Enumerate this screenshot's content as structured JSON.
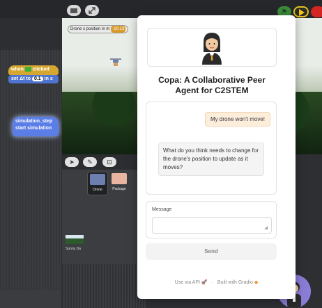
{
  "stage": {
    "readout_label": "Drone x position in m",
    "readout_value": "-20.13"
  },
  "palette": {
    "when_label": "when",
    "clicked_label": "clicked",
    "set_label": "set",
    "set_var": "Δt",
    "set_to": "to",
    "set_value": "0.1",
    "set_unit": "in s",
    "sim_block_line1": "simulation_step",
    "sim_block_line2": "start simulation"
  },
  "corral": {
    "sprites": [
      {
        "name": "Drone"
      },
      {
        "name": "Package"
      }
    ],
    "stage_name": "Sunny Da"
  },
  "modal": {
    "title": "Copa: A Collaborative Peer Agent for C2STEM",
    "messages": [
      {
        "role": "user",
        "text": "My drone won't move!"
      },
      {
        "role": "bot",
        "text": "What do you think needs to change for the drone's position to update as it moves?"
      }
    ],
    "input_label": "Message",
    "input_value": "",
    "send_label": "Send",
    "footer_api": "Use via API",
    "footer_sep": "·",
    "footer_built": "Built with Gradio"
  },
  "colors": {
    "user_bubble": "#fdeddb",
    "bot_bubble": "#f4f4f5",
    "hat_block": "#d6a730",
    "set_block": "#4f74cf"
  },
  "icons": {
    "api": "rocket-icon",
    "gradio": "gradio-logo-icon"
  }
}
